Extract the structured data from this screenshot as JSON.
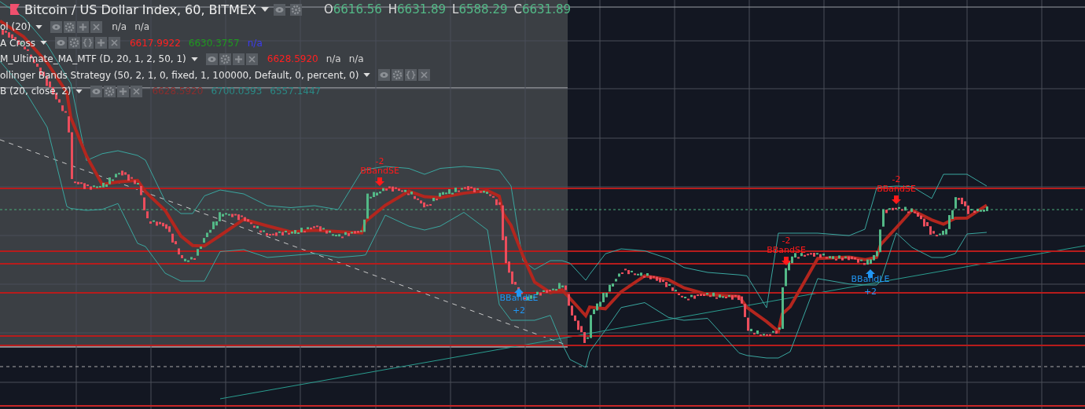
{
  "header": {
    "title": "Bitcoin / US Dollar Index, 60, BITMEX",
    "ohlc": [
      {
        "label": "O",
        "value": "6616.56"
      },
      {
        "label": "H",
        "value": "6631.89"
      },
      {
        "label": "L",
        "value": "6588.29"
      },
      {
        "label": "C",
        "value": "6631.89"
      }
    ]
  },
  "indicators": [
    {
      "name": "ol (20)",
      "source_button": false,
      "add_button": true,
      "values": [
        {
          "text": "n/a",
          "color": "#d6d6d6"
        },
        {
          "text": "n/a",
          "color": "#d6d6d6"
        }
      ]
    },
    {
      "name": "A Cross",
      "source_button": true,
      "add_button": true,
      "values": [
        {
          "text": "6617.9922",
          "color": "#ff2020"
        },
        {
          "text": "6630.3757",
          "color": "#1e9a1e"
        },
        {
          "text": "n/a",
          "color": "#3c3cf0"
        }
      ]
    },
    {
      "name": "M_Ultimate_MA_MTF (D, 20, 1, 2, 50, 1)",
      "source_button": false,
      "add_button": true,
      "values": [
        {
          "text": "6628.5920",
          "color": "#ff2020"
        },
        {
          "text": "n/a",
          "color": "#d6d6d6"
        },
        {
          "text": "n/a",
          "color": "#d6d6d6"
        }
      ]
    },
    {
      "name": "ollinger Bands Strategy (50, 2, 1, 0, fixed, 1, 100000, Default, 0, percent, 0)",
      "source_button": true,
      "add_button": false
    },
    {
      "name": "B (20, close, 2)",
      "source_button": false,
      "add_button": true,
      "values": [
        {
          "text": "6628.5920",
          "color": "#8a2e2e"
        },
        {
          "text": "6700.0393",
          "color": "#2a8a86"
        },
        {
          "text": "6557.1447",
          "color": "#2a8a86"
        }
      ]
    }
  ],
  "signals": [
    {
      "kind": "short",
      "count": "-2",
      "label": "BBandSE"
    },
    {
      "kind": "long",
      "count": "+2",
      "label": "BBandLE"
    },
    {
      "kind": "short",
      "count": "-2",
      "label": "BBandSE"
    },
    {
      "kind": "long",
      "count": "+2",
      "label": "BBandLE"
    },
    {
      "kind": "short",
      "count": "-2",
      "label": "BBandSE"
    }
  ]
}
